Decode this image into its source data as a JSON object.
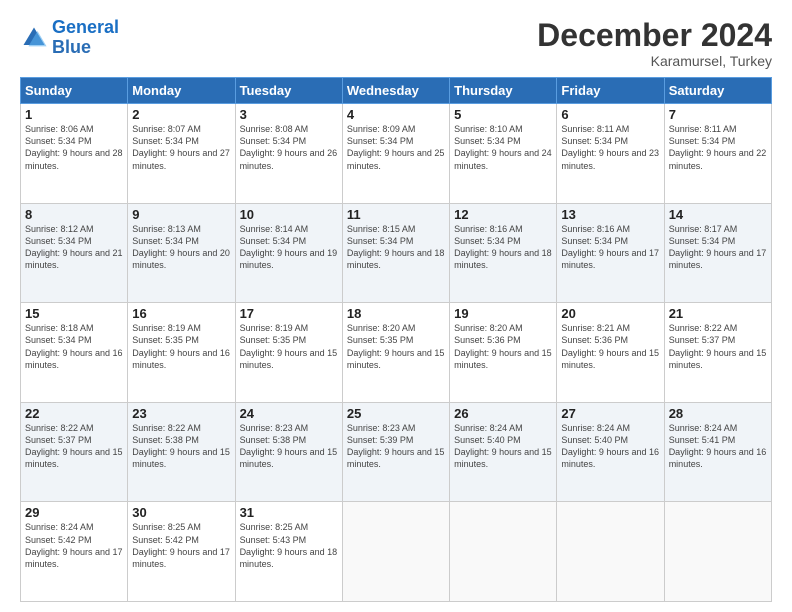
{
  "logo": {
    "line1": "General",
    "line2": "Blue"
  },
  "header": {
    "month": "December 2024",
    "location": "Karamursel, Turkey"
  },
  "days_of_week": [
    "Sunday",
    "Monday",
    "Tuesday",
    "Wednesday",
    "Thursday",
    "Friday",
    "Saturday"
  ],
  "weeks": [
    [
      {
        "day": "1",
        "sunrise": "8:06 AM",
        "sunset": "5:34 PM",
        "daylight": "9 hours and 28 minutes."
      },
      {
        "day": "2",
        "sunrise": "8:07 AM",
        "sunset": "5:34 PM",
        "daylight": "9 hours and 27 minutes."
      },
      {
        "day": "3",
        "sunrise": "8:08 AM",
        "sunset": "5:34 PM",
        "daylight": "9 hours and 26 minutes."
      },
      {
        "day": "4",
        "sunrise": "8:09 AM",
        "sunset": "5:34 PM",
        "daylight": "9 hours and 25 minutes."
      },
      {
        "day": "5",
        "sunrise": "8:10 AM",
        "sunset": "5:34 PM",
        "daylight": "9 hours and 24 minutes."
      },
      {
        "day": "6",
        "sunrise": "8:11 AM",
        "sunset": "5:34 PM",
        "daylight": "9 hours and 23 minutes."
      },
      {
        "day": "7",
        "sunrise": "8:11 AM",
        "sunset": "5:34 PM",
        "daylight": "9 hours and 22 minutes."
      }
    ],
    [
      {
        "day": "8",
        "sunrise": "8:12 AM",
        "sunset": "5:34 PM",
        "daylight": "9 hours and 21 minutes."
      },
      {
        "day": "9",
        "sunrise": "8:13 AM",
        "sunset": "5:34 PM",
        "daylight": "9 hours and 20 minutes."
      },
      {
        "day": "10",
        "sunrise": "8:14 AM",
        "sunset": "5:34 PM",
        "daylight": "9 hours and 19 minutes."
      },
      {
        "day": "11",
        "sunrise": "8:15 AM",
        "sunset": "5:34 PM",
        "daylight": "9 hours and 18 minutes."
      },
      {
        "day": "12",
        "sunrise": "8:16 AM",
        "sunset": "5:34 PM",
        "daylight": "9 hours and 18 minutes."
      },
      {
        "day": "13",
        "sunrise": "8:16 AM",
        "sunset": "5:34 PM",
        "daylight": "9 hours and 17 minutes."
      },
      {
        "day": "14",
        "sunrise": "8:17 AM",
        "sunset": "5:34 PM",
        "daylight": "9 hours and 17 minutes."
      }
    ],
    [
      {
        "day": "15",
        "sunrise": "8:18 AM",
        "sunset": "5:34 PM",
        "daylight": "9 hours and 16 minutes."
      },
      {
        "day": "16",
        "sunrise": "8:19 AM",
        "sunset": "5:35 PM",
        "daylight": "9 hours and 16 minutes."
      },
      {
        "day": "17",
        "sunrise": "8:19 AM",
        "sunset": "5:35 PM",
        "daylight": "9 hours and 15 minutes."
      },
      {
        "day": "18",
        "sunrise": "8:20 AM",
        "sunset": "5:35 PM",
        "daylight": "9 hours and 15 minutes."
      },
      {
        "day": "19",
        "sunrise": "8:20 AM",
        "sunset": "5:36 PM",
        "daylight": "9 hours and 15 minutes."
      },
      {
        "day": "20",
        "sunrise": "8:21 AM",
        "sunset": "5:36 PM",
        "daylight": "9 hours and 15 minutes."
      },
      {
        "day": "21",
        "sunrise": "8:22 AM",
        "sunset": "5:37 PM",
        "daylight": "9 hours and 15 minutes."
      }
    ],
    [
      {
        "day": "22",
        "sunrise": "8:22 AM",
        "sunset": "5:37 PM",
        "daylight": "9 hours and 15 minutes."
      },
      {
        "day": "23",
        "sunrise": "8:22 AM",
        "sunset": "5:38 PM",
        "daylight": "9 hours and 15 minutes."
      },
      {
        "day": "24",
        "sunrise": "8:23 AM",
        "sunset": "5:38 PM",
        "daylight": "9 hours and 15 minutes."
      },
      {
        "day": "25",
        "sunrise": "8:23 AM",
        "sunset": "5:39 PM",
        "daylight": "9 hours and 15 minutes."
      },
      {
        "day": "26",
        "sunrise": "8:24 AM",
        "sunset": "5:40 PM",
        "daylight": "9 hours and 15 minutes."
      },
      {
        "day": "27",
        "sunrise": "8:24 AM",
        "sunset": "5:40 PM",
        "daylight": "9 hours and 16 minutes."
      },
      {
        "day": "28",
        "sunrise": "8:24 AM",
        "sunset": "5:41 PM",
        "daylight": "9 hours and 16 minutes."
      }
    ],
    [
      {
        "day": "29",
        "sunrise": "8:24 AM",
        "sunset": "5:42 PM",
        "daylight": "9 hours and 17 minutes."
      },
      {
        "day": "30",
        "sunrise": "8:25 AM",
        "sunset": "5:42 PM",
        "daylight": "9 hours and 17 minutes."
      },
      {
        "day": "31",
        "sunrise": "8:25 AM",
        "sunset": "5:43 PM",
        "daylight": "9 hours and 18 minutes."
      },
      null,
      null,
      null,
      null
    ]
  ]
}
